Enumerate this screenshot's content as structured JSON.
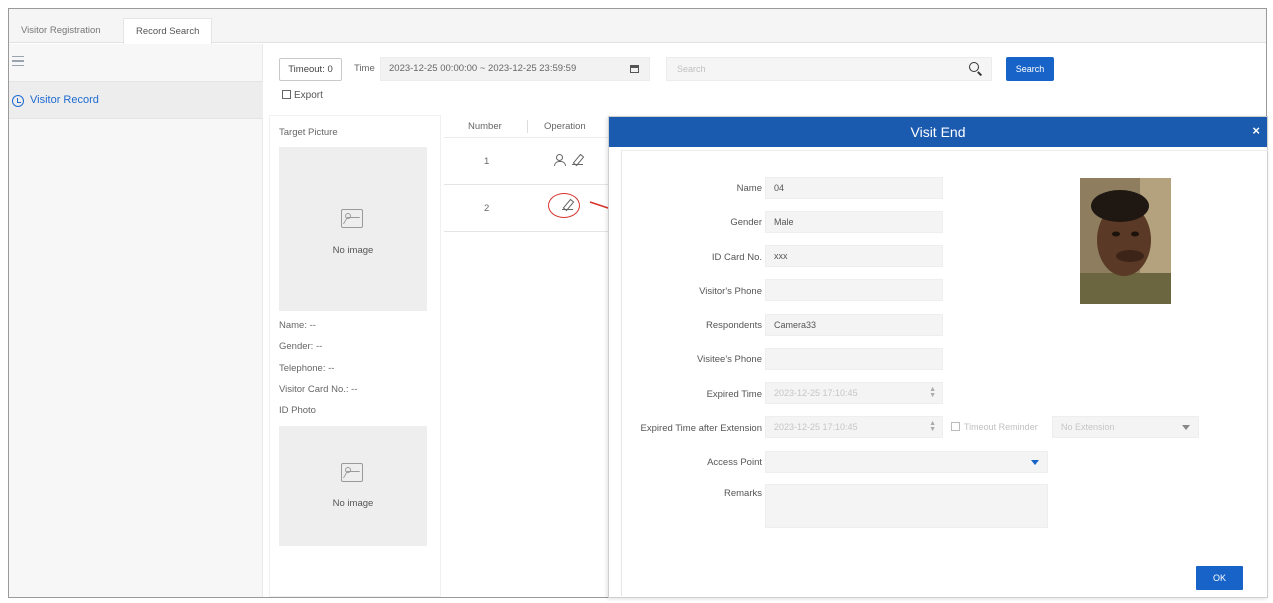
{
  "tabs": [
    {
      "label": "Visitor Registration",
      "active": false
    },
    {
      "label": "Record Search",
      "active": true
    }
  ],
  "sidebar": {
    "items": [
      {
        "label": "Visitor Record",
        "icon": "clock-icon",
        "active": true
      }
    ]
  },
  "toolbar": {
    "timeout_label": "Timeout: 0",
    "time_label": "Time",
    "time_range": "2023-12-25 00:00:00  ~  2023-12-25 23:59:59",
    "search_placeholder": "Search",
    "search_button": "Search",
    "export_label": "Export"
  },
  "target_panel": {
    "title": "Target Picture",
    "no_image": "No image",
    "fields": [
      "Name: --",
      "Gender: --",
      "Telephone: --",
      "Visitor Card No.: --",
      "ID Photo"
    ]
  },
  "table": {
    "headers": [
      "Number",
      "Operation"
    ],
    "rows": [
      {
        "number": "1"
      },
      {
        "number": "2"
      }
    ]
  },
  "dialog": {
    "title": "Visit End",
    "close": "×",
    "fields": {
      "name": {
        "label": "Name",
        "value": "04"
      },
      "gender": {
        "label": "Gender",
        "value": "Male"
      },
      "id_card": {
        "label": "ID Card No.",
        "value": "xxx"
      },
      "visitor_phone": {
        "label": "Visitor's Phone",
        "value": ""
      },
      "respondents": {
        "label": "Respondents",
        "value": "Camera33"
      },
      "visitee_phone": {
        "label": "Visitee's Phone",
        "value": ""
      },
      "expired_time": {
        "label": "Expired Time",
        "value": "2023-12-25 17:10:45"
      },
      "expired_ext": {
        "label": "Expired Time after Extension",
        "value": "2023-12-25 17:10:45"
      },
      "timeout_reminder": {
        "label": "Timeout Reminder",
        "checked": false
      },
      "extension": {
        "value": "No Extension"
      },
      "access_point": {
        "label": "Access Point",
        "value": ""
      },
      "remarks": {
        "label": "Remarks",
        "value": ""
      }
    },
    "ok_button": "OK"
  },
  "colors": {
    "accent": "#1763c7",
    "dialog_header": "#1a5aaf",
    "annotation_red": "#d8322b"
  }
}
